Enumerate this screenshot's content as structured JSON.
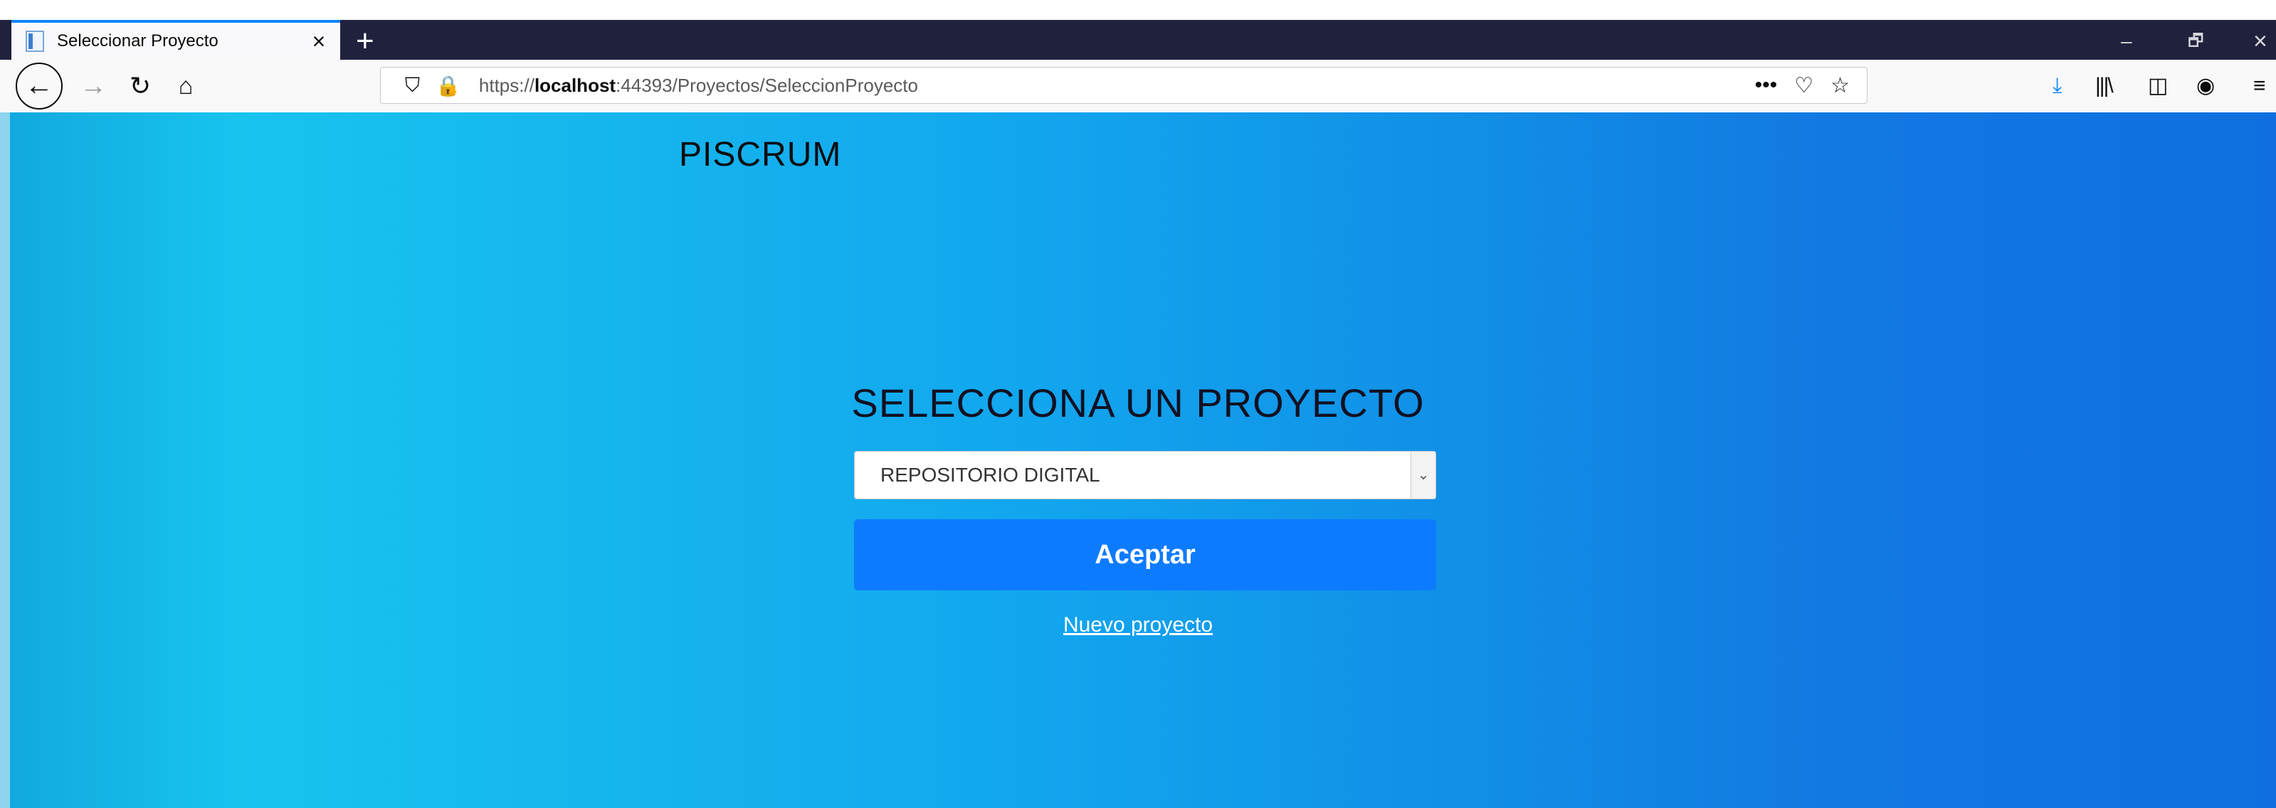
{
  "browser": {
    "tab_title": "Seleccionar Proyecto",
    "tab_close": "×",
    "new_tab": "+",
    "url_scheme": "https://",
    "url_host": "localhost",
    "url_rest": ":44393/Proyectos/SeleccionProyecto",
    "page_actions": "•••",
    "window_controls": {
      "minimize": "–",
      "restore": "🗗",
      "close": "×"
    }
  },
  "page": {
    "brand": "PISCRUM",
    "heading": "SELECCIONA UN PROYECTO",
    "project_select": {
      "selected": "REPOSITORIO DIGITAL"
    },
    "accept_label": "Aceptar",
    "new_project_link": "Nuevo proyecto"
  },
  "colors": {
    "accent": "#0d7bff",
    "tabbar": "#20213d",
    "background_start": "#17c4ee",
    "background_end": "#0f6fe0"
  }
}
